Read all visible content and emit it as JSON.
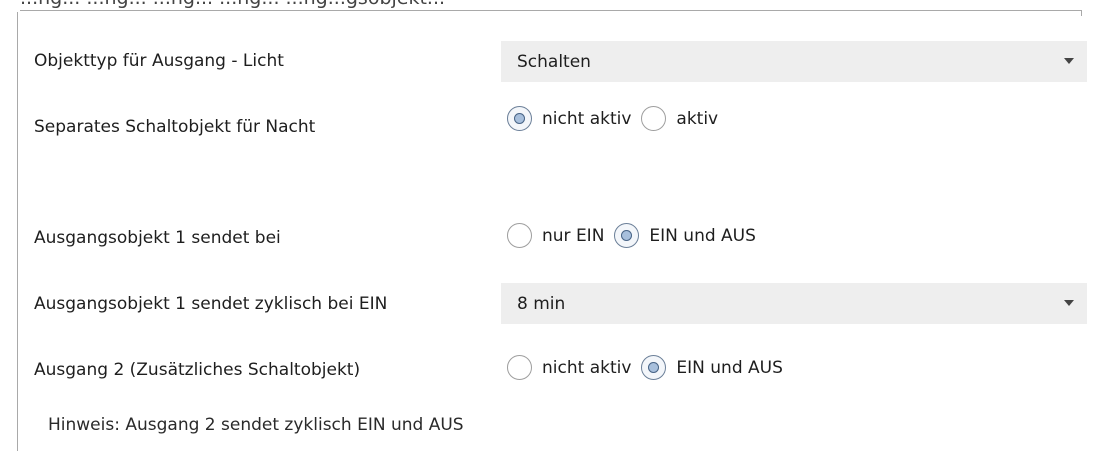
{
  "header": {
    "partial_text": "...ng... ...ng... ...ng... ...ng... ...ng...gsobjekt..."
  },
  "params": [
    {
      "label": "Objekttyp für Ausgang - Licht",
      "type": "select",
      "value": "Schalten"
    },
    {
      "label": "Separates Schaltobjekt für Nacht",
      "type": "radio",
      "options": [
        {
          "label": "nicht aktiv",
          "checked": true
        },
        {
          "label": "aktiv",
          "checked": false
        }
      ]
    },
    {
      "label": "Ausgangsobjekt 1 sendet bei",
      "type": "radio",
      "options": [
        {
          "label": "nur EIN",
          "checked": false
        },
        {
          "label": "EIN und AUS",
          "checked": true
        }
      ]
    },
    {
      "label": "Ausgangsobjekt 1 sendet zyklisch bei EIN",
      "type": "select",
      "value": "8 min"
    },
    {
      "label": "Ausgang 2 (Zusätzliches Schaltobjekt)",
      "type": "radio",
      "options": [
        {
          "label": "nicht aktiv",
          "checked": false
        },
        {
          "label": "EIN und AUS",
          "checked": true
        }
      ]
    }
  ],
  "hint": "Hinweis: Ausgang 2 sendet zyklisch EIN und AUS",
  "colors": {
    "select_bg": "#eeeeee",
    "radio_checked": "#a7bfdc",
    "border": "#a9a9a9"
  }
}
